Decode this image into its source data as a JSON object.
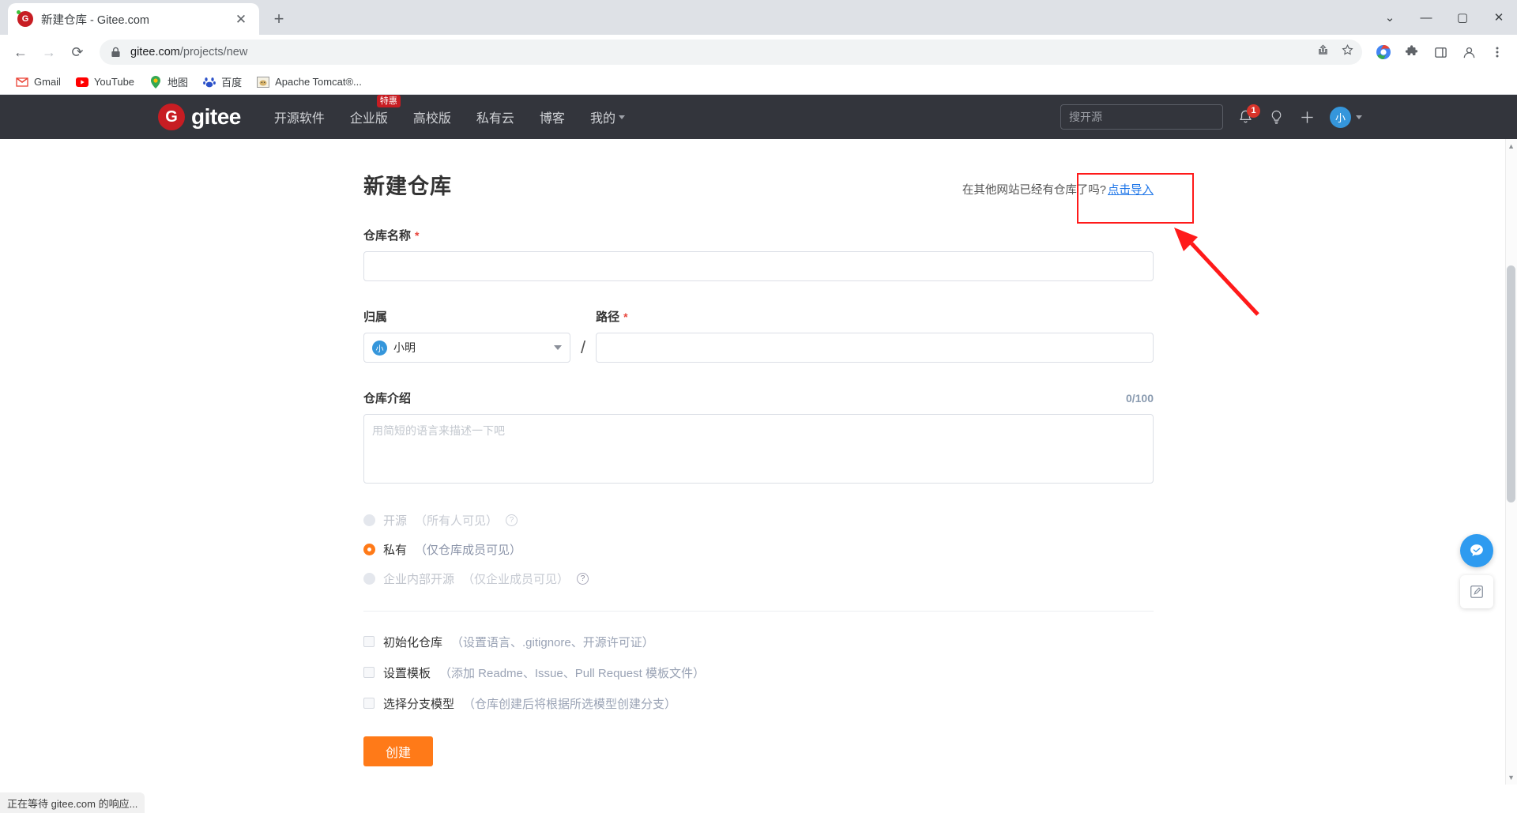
{
  "browser": {
    "tab": {
      "title": "新建仓库 - Gitee.com",
      "favicon_text": "G",
      "close_icon": "close-icon"
    },
    "new_tab_label": "+",
    "window_controls": {
      "more": "⌄",
      "minimize": "—",
      "maximize": "▢",
      "close": "✕"
    },
    "nav": {
      "back": "←",
      "forward": "→",
      "reload": "⟳"
    },
    "omnibox": {
      "lock_icon": "lock-icon",
      "url_host": "gitee.com",
      "url_path": "/projects/new",
      "share_icon": "share-icon",
      "star_icon": "star-icon"
    },
    "toolbar_icons": [
      "chrome-profile-icon",
      "extensions-icon",
      "sidepanel-icon",
      "account-icon",
      "menu-icon"
    ],
    "bookmarks": [
      {
        "label": "Gmail",
        "icon": "M"
      },
      {
        "label": "YouTube",
        "icon": "▶"
      },
      {
        "label": "地图",
        "icon": "◉"
      },
      {
        "label": "百度",
        "icon": "🐾"
      },
      {
        "label": "Apache Tomcat®...",
        "icon": "🐱"
      }
    ],
    "status_text": "正在等待 gitee.com 的响应..."
  },
  "gitee_header": {
    "logo_mark": "G",
    "logo_text": "gitee",
    "nav_items": [
      {
        "label": "开源软件",
        "badge": ""
      },
      {
        "label": "企业版",
        "badge": "特惠"
      },
      {
        "label": "高校版",
        "badge": ""
      },
      {
        "label": "私有云",
        "badge": ""
      },
      {
        "label": "博客",
        "badge": ""
      },
      {
        "label": "我的",
        "badge": "",
        "has_caret": true
      }
    ],
    "search_placeholder": "搜开源",
    "notification_count": "1",
    "avatar_text": "小"
  },
  "main": {
    "title": "新建仓库",
    "import_prompt": "在其他网站已经有仓库了吗?",
    "import_link": "点击导入",
    "repo_name": {
      "label": "仓库名称",
      "required": "*",
      "value": "",
      "placeholder": ""
    },
    "owner": {
      "label": "归属",
      "avatar_text": "小",
      "value": "小明"
    },
    "path": {
      "label": "路径",
      "required": "*",
      "separator": "/",
      "value": "",
      "placeholder": ""
    },
    "description": {
      "label": "仓库介绍",
      "counter": "0/100",
      "placeholder": "用简短的语言来描述一下吧",
      "value": ""
    },
    "visibility": [
      {
        "main": "开源",
        "sub": "（所有人可见）",
        "selected": false,
        "disabled": true,
        "help": "?"
      },
      {
        "main": "私有",
        "sub": "（仅仓库成员可见）",
        "selected": true,
        "disabled": false,
        "help": ""
      },
      {
        "main": "企业内部开源",
        "sub": "（仅企业成员可见）",
        "selected": false,
        "disabled": true,
        "help": "?"
      }
    ],
    "options": [
      {
        "main": "初始化仓库",
        "sub": "（设置语言、.gitignore、开源许可证）",
        "checked": false
      },
      {
        "main": "设置模板",
        "sub": "（添加 Readme、Issue、Pull Request 模板文件）",
        "checked": false
      },
      {
        "main": "选择分支模型",
        "sub": "（仓库创建后将根据所选模型创建分支）",
        "checked": false
      }
    ],
    "submit_label": "创建"
  },
  "float_widgets": [
    {
      "name": "feedback-chat-icon",
      "glyph": "✆"
    },
    {
      "name": "edit-note-icon",
      "glyph": "✎"
    }
  ],
  "colors": {
    "accent_orange": "#ff7a18",
    "gitee_red": "#c71d23",
    "header_bg": "#33353c",
    "link_blue": "#1a73e8",
    "annotation_red": "#ff1a1a"
  }
}
